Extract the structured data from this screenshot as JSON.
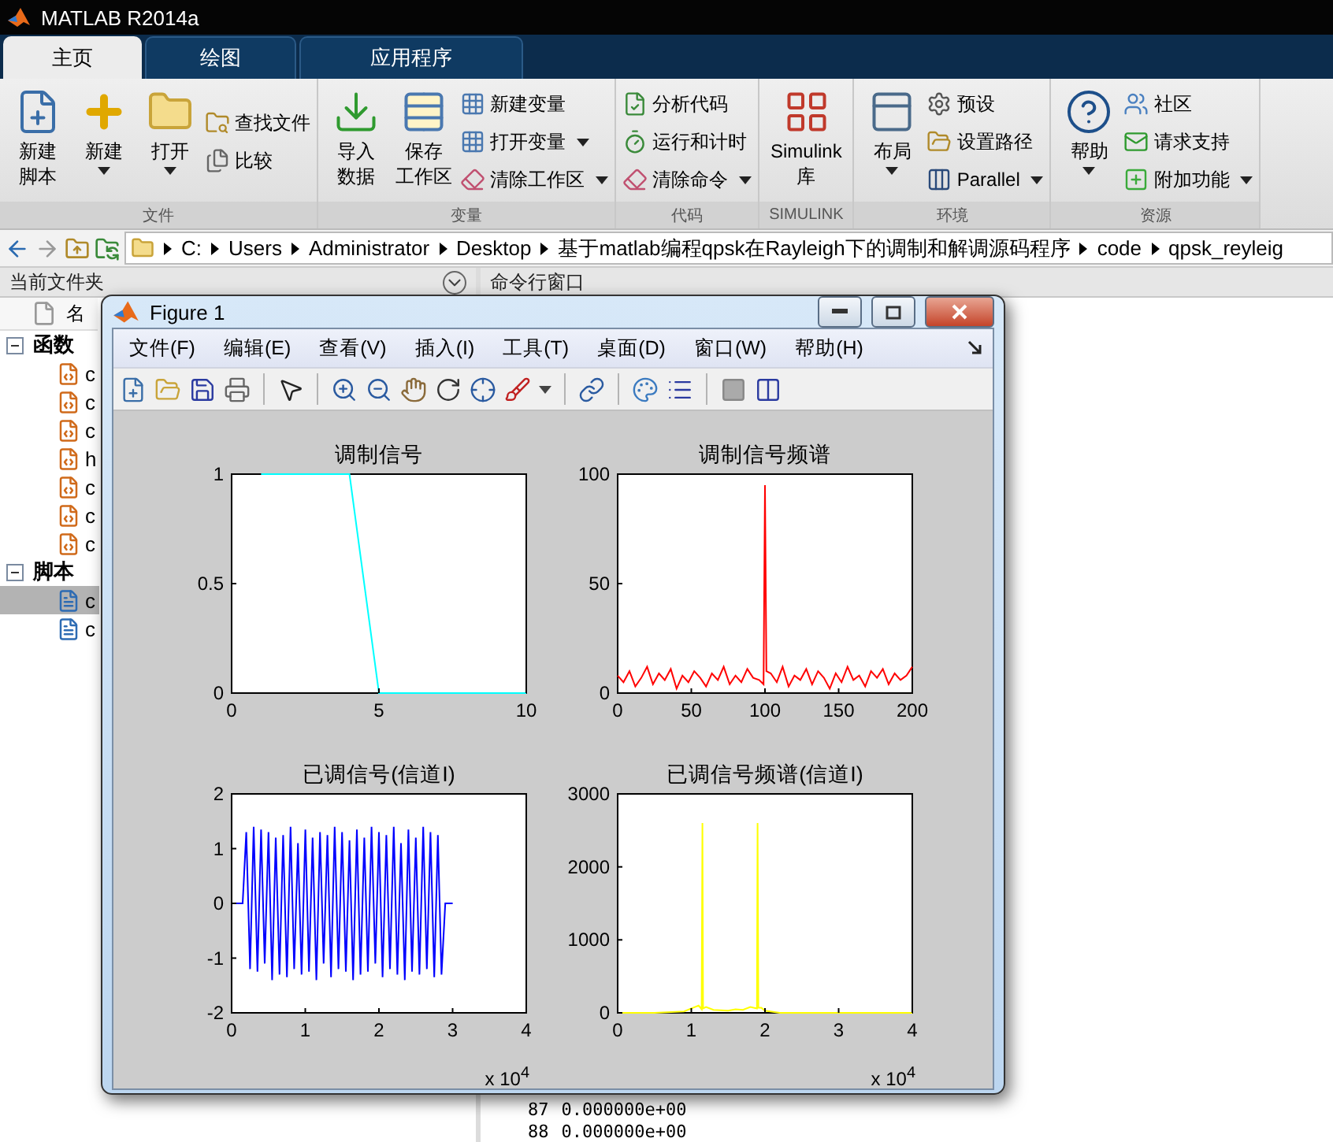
{
  "window": {
    "title": "MATLAB R2014a"
  },
  "tabs": [
    {
      "label": "主页",
      "selected": true
    },
    {
      "label": "绘图",
      "selected": false
    },
    {
      "label": "应用程序",
      "selected": false
    }
  ],
  "toolstrip": [
    {
      "title": "文件",
      "items": [
        {
          "kind": "large",
          "lines": [
            "新建",
            "脚本"
          ],
          "dropdown": false
        },
        {
          "kind": "large",
          "lines": [
            "新建"
          ],
          "dropdown": true
        },
        {
          "kind": "large",
          "lines": [
            "打开"
          ],
          "dropdown": true
        },
        {
          "kind": "small",
          "label": "查找文件",
          "dropdown": false
        },
        {
          "kind": "small",
          "label": "比较",
          "dropdown": false
        }
      ]
    },
    {
      "title": "变量",
      "items": [
        {
          "kind": "large",
          "lines": [
            "导入",
            "数据"
          ],
          "dropdown": false
        },
        {
          "kind": "large",
          "lines": [
            "保存",
            "工作区"
          ],
          "dropdown": false
        },
        {
          "kind": "small",
          "label": "新建变量",
          "dropdown": false
        },
        {
          "kind": "small",
          "label": "打开变量",
          "dropdown": true
        },
        {
          "kind": "small",
          "label": "清除工作区",
          "dropdown": true
        }
      ]
    },
    {
      "title": "代码",
      "items": [
        {
          "kind": "small",
          "label": "分析代码",
          "dropdown": false
        },
        {
          "kind": "small",
          "label": "运行和计时",
          "dropdown": false
        },
        {
          "kind": "small",
          "label": "清除命令",
          "dropdown": true
        }
      ]
    },
    {
      "title": "SIMULINK",
      "items": [
        {
          "kind": "large",
          "lines": [
            "Simulink",
            "库"
          ],
          "dropdown": false
        }
      ]
    },
    {
      "title": "环境",
      "items": [
        {
          "kind": "large",
          "lines": [
            "布局"
          ],
          "dropdown": true
        },
        {
          "kind": "small",
          "label": "预设",
          "dropdown": false
        },
        {
          "kind": "small",
          "label": "设置路径",
          "dropdown": false
        },
        {
          "kind": "small",
          "label": "Parallel",
          "dropdown": true
        }
      ]
    },
    {
      "title": "资源",
      "items": [
        {
          "kind": "large",
          "lines": [
            "帮助"
          ],
          "dropdown": true
        },
        {
          "kind": "small",
          "label": "社区",
          "dropdown": false
        },
        {
          "kind": "small",
          "label": "请求支持",
          "dropdown": false
        },
        {
          "kind": "small",
          "label": "附加功能",
          "dropdown": true
        }
      ]
    }
  ],
  "address_bar": {
    "segments": [
      "C:",
      "Users",
      "Administrator",
      "Desktop",
      "基于matlab编程qpsk在Rayleigh下的调制和解调源码程序",
      "code",
      "qpsk_reyleig"
    ]
  },
  "current_folder": {
    "title": "当前文件夹",
    "column": "名",
    "groups": [
      {
        "label": "函数",
        "expanded": true,
        "items": [
          {
            "name": "c",
            "selected": false
          },
          {
            "name": "c",
            "selected": false
          },
          {
            "name": "c",
            "selected": false
          },
          {
            "name": "h",
            "selected": false
          },
          {
            "name": "c",
            "selected": false
          },
          {
            "name": "c",
            "selected": false
          },
          {
            "name": "c",
            "selected": false
          }
        ]
      },
      {
        "label": "脚本",
        "expanded": true,
        "items": [
          {
            "name": "c",
            "selected": true
          },
          {
            "name": "c",
            "selected": false
          }
        ]
      }
    ]
  },
  "command_window": {
    "title": "命令行窗口",
    "lines": [
      {
        "number": "87",
        "value": "0.000000e+00"
      },
      {
        "number": "88",
        "value": "0.000000e+00"
      }
    ]
  },
  "figure": {
    "title": "Figure 1",
    "menu": [
      "文件(F)",
      "编辑(E)",
      "查看(V)",
      "插入(I)",
      "工具(T)",
      "桌面(D)",
      "窗口(W)",
      "帮助(H)"
    ],
    "subplots": [
      {
        "chart_data": {
          "type": "line",
          "title": "调制信号",
          "x": [
            1,
            4,
            5,
            10
          ],
          "series": [
            {
              "color": "#00ffff",
              "values": [
                1,
                1,
                0,
                0
              ]
            }
          ],
          "xlim": [
            0,
            10
          ],
          "ylim": [
            0,
            1
          ],
          "xticks": [
            0,
            5,
            10
          ],
          "yticks": [
            0,
            0.5,
            1
          ]
        }
      },
      {
        "chart_data": {
          "type": "line",
          "title": "调制信号频谱",
          "x": [
            0,
            4,
            8,
            12,
            16,
            20,
            24,
            28,
            32,
            36,
            40,
            44,
            48,
            52,
            56,
            60,
            64,
            68,
            72,
            76,
            80,
            84,
            88,
            92,
            96,
            99,
            100,
            101,
            104,
            108,
            112,
            116,
            120,
            124,
            128,
            132,
            136,
            140,
            144,
            148,
            152,
            156,
            160,
            164,
            168,
            172,
            176,
            180,
            184,
            188,
            192,
            196,
            200
          ],
          "series": [
            {
              "color": "#ff0000",
              "values": [
                8,
                5,
                10,
                3,
                7,
                12,
                4,
                9,
                6,
                11,
                2,
                8,
                5,
                10,
                7,
                3,
                9,
                6,
                12,
                4,
                8,
                5,
                11,
                7,
                6,
                4,
                95,
                10,
                9,
                5,
                12,
                3,
                8,
                6,
                11,
                4,
                10,
                7,
                2,
                9,
                5,
                12,
                6,
                8,
                3,
                10,
                7,
                11,
                4,
                9,
                6,
                8,
                12
              ]
            }
          ],
          "xlim": [
            0,
            200
          ],
          "ylim": [
            0,
            100
          ],
          "xticks": [
            0,
            50,
            100,
            150,
            200
          ],
          "yticks": [
            0,
            50,
            100
          ]
        }
      },
      {
        "chart_data": {
          "type": "line",
          "title": "已调信号(信道I)",
          "x": [
            0,
            0.15,
            0.2,
            0.25,
            0.3,
            0.35,
            0.4,
            0.45,
            0.5,
            0.55,
            0.6,
            0.65,
            0.7,
            0.75,
            0.8,
            0.85,
            0.9,
            0.95,
            1,
            1.05,
            1.1,
            1.15,
            1.2,
            1.25,
            1.3,
            1.35,
            1.4,
            1.45,
            1.5,
            1.55,
            1.6,
            1.65,
            1.7,
            1.75,
            1.8,
            1.85,
            1.9,
            1.95,
            2,
            2.05,
            2.1,
            2.15,
            2.2,
            2.25,
            2.3,
            2.35,
            2.4,
            2.45,
            2.5,
            2.55,
            2.6,
            2.65,
            2.7,
            2.75,
            2.8,
            2.85,
            2.9,
            3
          ],
          "series": [
            {
              "color": "#0000ff",
              "values": [
                0,
                0,
                1.3,
                -1.2,
                1.4,
                -1.25,
                1.35,
                -1.1,
                1.3,
                -1.4,
                1.2,
                -1.3,
                1.25,
                -1.35,
                1.4,
                -1.2,
                1.1,
                -1.3,
                1.35,
                -1.25,
                1.2,
                -1.4,
                1.3,
                -1.1,
                1.25,
                -1.35,
                1.4,
                -1.2,
                1.3,
                -1.25,
                1.15,
                -1.4,
                1.35,
                -1.3,
                1.2,
                -1.25,
                1.4,
                -1.1,
                1.3,
                -1.35,
                1.25,
                -1.2,
                1.4,
                -1.3,
                1.1,
                -1.4,
                1.35,
                -1.25,
                1.2,
                -1.3,
                1.4,
                -1.2,
                1.3,
                -1.35,
                1.25,
                -1.3,
                0,
                0
              ]
            }
          ],
          "xlim": [
            0,
            4
          ],
          "ylim": [
            -2,
            2
          ],
          "xticks": [
            0,
            1,
            2,
            3,
            4
          ],
          "yticks": [
            -2,
            -1,
            0,
            1,
            2
          ]
        },
        "exponent_label": "x 10$^{4}$"
      },
      {
        "chart_data": {
          "type": "line",
          "title": "已调信号频谱(信道I)",
          "x": [
            0,
            0.5,
            0.9,
            1,
            1.1,
            1.14,
            1.15,
            1.16,
            1.2,
            1.3,
            1.5,
            1.6,
            1.7,
            1.8,
            1.89,
            1.9,
            1.91,
            1.95,
            2,
            2.2,
            2.5,
            3,
            4
          ],
          "series": [
            {
              "color": "#ffff00",
              "values": [
                0,
                0,
                20,
                60,
                100,
                50,
                2600,
                60,
                80,
                40,
                30,
                50,
                40,
                80,
                60,
                2600,
                70,
                70,
                30,
                0,
                0,
                0,
                0
              ]
            }
          ],
          "xlim": [
            0,
            4
          ],
          "ylim": [
            0,
            3000
          ],
          "xticks": [
            0,
            1,
            2,
            3,
            4
          ],
          "yticks": [
            0,
            1000,
            2000,
            3000
          ]
        },
        "exponent_label": "x 10$^{4}$"
      }
    ]
  }
}
